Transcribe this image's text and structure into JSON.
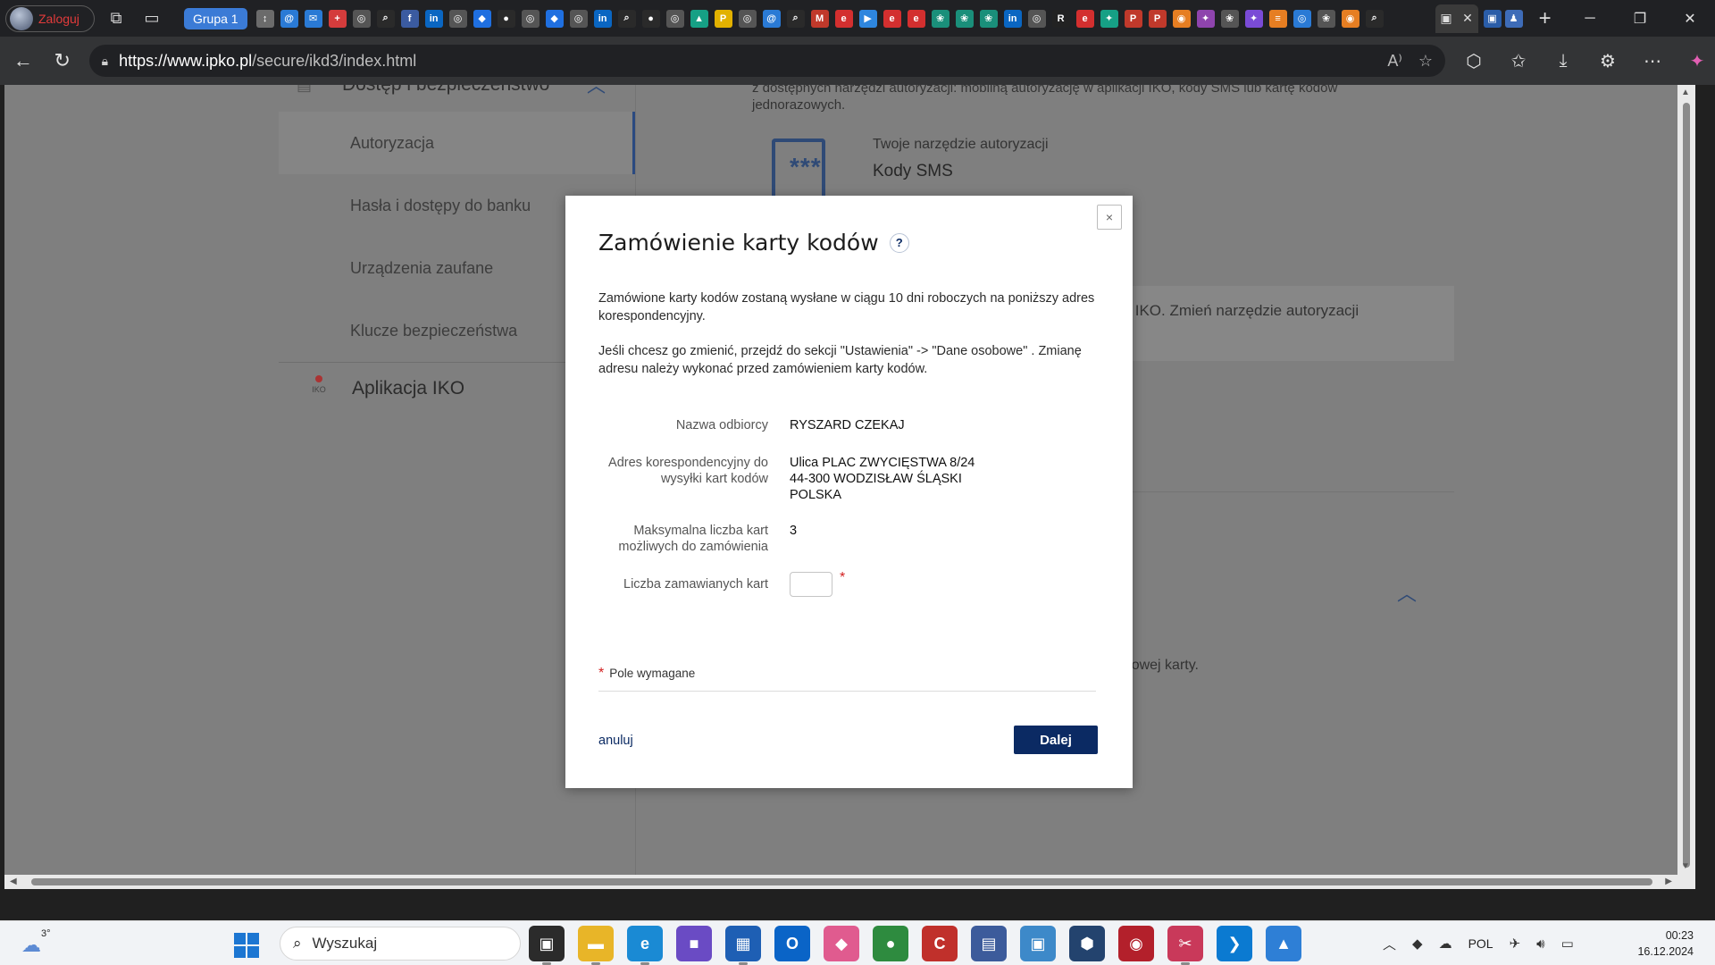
{
  "browser": {
    "profile_label": "Zaloguj",
    "tab_group_label": "Grupa 1",
    "url_host": "https://www.ipko.pl",
    "url_path": "/secure/ikd3/index.html",
    "tab_favicons": [
      {
        "name": "nested-tabs-icon",
        "glyph": "↕",
        "color": "#6b6b6b"
      },
      {
        "name": "mail-icon",
        "glyph": "@",
        "color": "#2a7ad5"
      },
      {
        "name": "mail-icon-2",
        "glyph": "✉",
        "color": "#2a7ad5"
      },
      {
        "name": "plus-cross-icon",
        "glyph": "+",
        "color": "#d43c3c"
      },
      {
        "name": "globe-icon",
        "glyph": "◎",
        "color": "#555"
      },
      {
        "name": "search-tab-icon",
        "glyph": "⌕",
        "color": "#2a2a2a"
      },
      {
        "name": "facebook-icon",
        "glyph": "f",
        "color": "#3b5ba0"
      },
      {
        "name": "linkedin-icon",
        "glyph": "in",
        "color": "#0a66c2"
      },
      {
        "name": "globe-icon-2",
        "glyph": "◎",
        "color": "#555"
      },
      {
        "name": "dropbox-icon",
        "glyph": "◆",
        "color": "#1f6fe0"
      },
      {
        "name": "dark-tab-icon",
        "glyph": "●",
        "color": "#2a2a2a"
      },
      {
        "name": "globe-icon-3",
        "glyph": "◎",
        "color": "#555"
      },
      {
        "name": "dropbox-icon-2",
        "glyph": "◆",
        "color": "#1f6fe0"
      },
      {
        "name": "globe-icon-4",
        "glyph": "◎",
        "color": "#555"
      },
      {
        "name": "linkedin-icon-2",
        "glyph": "in",
        "color": "#0a66c2"
      },
      {
        "name": "search-tab-icon-2",
        "glyph": "⌕",
        "color": "#2a2a2a"
      },
      {
        "name": "dark-tab-icon-2",
        "glyph": "●",
        "color": "#2a2a2a"
      },
      {
        "name": "globe-icon-5",
        "glyph": "◎",
        "color": "#555"
      },
      {
        "name": "maps-icon",
        "glyph": "▲",
        "color": "#16a085"
      },
      {
        "name": "parking-icon",
        "glyph": "P",
        "color": "#e2b100"
      },
      {
        "name": "globe-icon-6",
        "glyph": "◎",
        "color": "#555"
      },
      {
        "name": "mail-icon-3",
        "glyph": "@",
        "color": "#2a7ad5"
      },
      {
        "name": "search-tab-icon-3",
        "glyph": "⌕",
        "color": "#2a2a2a"
      },
      {
        "name": "gmail-icon",
        "glyph": "M",
        "color": "#c0392b"
      },
      {
        "name": "e-icon",
        "glyph": "e",
        "color": "#d32f2f"
      },
      {
        "name": "play-icon",
        "glyph": "▶",
        "color": "#2e86de"
      },
      {
        "name": "e-icon-2",
        "glyph": "e",
        "color": "#d32f2f"
      },
      {
        "name": "e-icon-3",
        "glyph": "e",
        "color": "#d32f2f"
      },
      {
        "name": "brain-icon",
        "glyph": "❀",
        "color": "#1a8f7a"
      },
      {
        "name": "brain-icon-2",
        "glyph": "❀",
        "color": "#1a8f7a"
      },
      {
        "name": "brain-icon-3",
        "glyph": "❀",
        "color": "#1a8f7a"
      },
      {
        "name": "linkedin-icon-3",
        "glyph": "in",
        "color": "#0a66c2"
      },
      {
        "name": "globe-icon-7",
        "glyph": "◎",
        "color": "#555"
      },
      {
        "name": "r-icon",
        "glyph": "R",
        "color": "#222"
      },
      {
        "name": "e-icon-4",
        "glyph": "e",
        "color": "#d32f2f"
      },
      {
        "name": "puzzle-icon",
        "glyph": "✦",
        "color": "#16a085"
      },
      {
        "name": "pdf-icon",
        "glyph": "P",
        "color": "#c0392b"
      },
      {
        "name": "pdf-icon-2",
        "glyph": "P",
        "color": "#c0392b"
      },
      {
        "name": "chrome-icon",
        "glyph": "◉",
        "color": "#e67e22"
      },
      {
        "name": "ai-icon",
        "glyph": "✦",
        "color": "#8e44ad"
      },
      {
        "name": "openai-icon",
        "glyph": "❀",
        "color": "#555"
      },
      {
        "name": "sparkle-icon",
        "glyph": "✦",
        "color": "#7a4bd6"
      },
      {
        "name": "color-bars-icon",
        "glyph": "≡",
        "color": "#e67e22"
      },
      {
        "name": "globe-icon-8",
        "glyph": "◎",
        "color": "#2a7ad5"
      },
      {
        "name": "openai-icon-2",
        "glyph": "❀",
        "color": "#555"
      },
      {
        "name": "chrome-icon-2",
        "glyph": "◉",
        "color": "#e67e22"
      },
      {
        "name": "search-tab-icon-4",
        "glyph": "⌕",
        "color": "#2a2a2a"
      }
    ]
  },
  "sidebar": {
    "section_title": "Dostęp i bezpieczeństwo",
    "items": [
      {
        "label": "Autoryzacja"
      },
      {
        "label": "Hasła i dostępy do banku"
      },
      {
        "label": "Urządzenia zaufane"
      },
      {
        "label": "Klucze bezpieczeństwa"
      }
    ],
    "iko_item": "Aplikacja IKO",
    "iko_logo_text": "IKO"
  },
  "main": {
    "intro": "z dostępnych narzędzi autoryzacji: mobilną autoryzację w aplikacji IKO, kody SMS lub kartę kodów jednorazowych.",
    "card_icon_text": "***",
    "tool_label": "Twoje narzędzie autoryzacji",
    "tool_value": "Kody SMS",
    "info_text": "kacji IKO. Zmień narzędzie autoryzacji",
    "note_text": "nie nowej karty."
  },
  "modal": {
    "title": "Zamówienie karty kodów",
    "help": "?",
    "para1": "Zamówione karty kodów zostaną wysłane w ciągu 10 dni roboczych na poniższy adres korespondencyjny.",
    "para2": "Jeśli chcesz go zmienić, przejdź do sekcji \"Ustawienia\" -> \"Dane osobowe\" . Zmianę adresu należy wykonać przed zamówieniem karty kodów.",
    "recipient_label": "Nazwa odbiorcy",
    "recipient_value": "RYSZARD CZEKAJ",
    "address_label": "Adres korespondencyjny do wysyłki kart kodów",
    "address_value": "Ulica PLAC ZWYCIĘSTWA 8/24\n44-300 WODZISŁAW ŚLĄSKI\nPOLSKA",
    "max_label": "Maksymalna liczba kart możliwych do zamówienia",
    "max_value": "3",
    "qty_label": "Liczba zamawianych kart",
    "qty_value": "",
    "required_mark": "*",
    "required_note": "Pole wymagane",
    "cancel": "anuluj",
    "next": "Dalej",
    "close": "×"
  },
  "taskbar": {
    "weather_temp": "3°",
    "search_placeholder": "Wyszukaj",
    "apps": [
      {
        "name": "task-view-icon",
        "glyph": "▣",
        "bg": "#2b2b2b"
      },
      {
        "name": "file-explorer-icon",
        "glyph": "▬",
        "bg": "#e8b528"
      },
      {
        "name": "edge-icon",
        "glyph": "e",
        "bg": "#1a8ad4"
      },
      {
        "name": "save-app-icon",
        "glyph": "■",
        "bg": "#6a4bc4"
      },
      {
        "name": "store-icon",
        "glyph": "▦",
        "bg": "#1e5fb4"
      },
      {
        "name": "outlook-icon",
        "glyph": "O",
        "bg": "#0a64c7"
      },
      {
        "name": "paint-icon",
        "glyph": "◆",
        "bg": "#e05b8f"
      },
      {
        "name": "xbox-like-icon",
        "glyph": "●",
        "bg": "#2e8b3f"
      },
      {
        "name": "ccleaner-icon",
        "glyph": "C",
        "bg": "#c0302b"
      },
      {
        "name": "network-icon",
        "glyph": "▤",
        "bg": "#3c5b9b"
      },
      {
        "name": "rdp-icon",
        "glyph": "▣",
        "bg": "#3d89c9"
      },
      {
        "name": "box-icon",
        "glyph": "⬢",
        "bg": "#23436e"
      },
      {
        "name": "davinci-icon",
        "glyph": "◉",
        "bg": "#b3202b"
      },
      {
        "name": "snipping-icon",
        "glyph": "✂",
        "bg": "#c9395a"
      },
      {
        "name": "vscode-icon",
        "glyph": "❯",
        "bg": "#0b7ad1"
      },
      {
        "name": "photos-icon",
        "glyph": "▲",
        "bg": "#2e7fd6"
      }
    ],
    "language": "POL",
    "time": "00:23",
    "date": "16.12.2024"
  }
}
